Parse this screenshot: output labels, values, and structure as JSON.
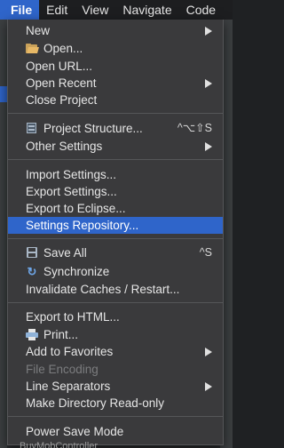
{
  "menubar": {
    "items": [
      {
        "label": "File",
        "active": true
      },
      {
        "label": "Edit"
      },
      {
        "label": "View"
      },
      {
        "label": "Navigate"
      },
      {
        "label": "Code"
      }
    ]
  },
  "file_menu": {
    "new": {
      "label": "New",
      "submenu": true
    },
    "open": {
      "label": "Open...",
      "icon": "folder-icon"
    },
    "open_url": {
      "label": "Open URL..."
    },
    "open_recent": {
      "label": "Open Recent",
      "submenu": true
    },
    "close_project": {
      "label": "Close Project"
    },
    "project_structure": {
      "label": "Project Structure...",
      "icon": "project-structure-icon",
      "shortcut": "^⌥⇧S"
    },
    "other_settings": {
      "label": "Other Settings",
      "submenu": true
    },
    "import_settings": {
      "label": "Import Settings..."
    },
    "export_settings": {
      "label": "Export Settings..."
    },
    "export_eclipse": {
      "label": "Export to Eclipse..."
    },
    "settings_repository": {
      "label": "Settings Repository...",
      "selected": true
    },
    "save_all": {
      "label": "Save All",
      "icon": "save-icon",
      "shortcut": "^S"
    },
    "synchronize": {
      "label": "Synchronize",
      "icon": "sync-icon"
    },
    "invalidate_caches": {
      "label": "Invalidate Caches / Restart..."
    },
    "export_html": {
      "label": "Export to HTML..."
    },
    "print": {
      "label": "Print...",
      "icon": "print-icon"
    },
    "add_favorites": {
      "label": "Add to Favorites",
      "submenu": true
    },
    "file_encoding": {
      "label": "File Encoding",
      "disabled": true
    },
    "line_separators": {
      "label": "Line Separators",
      "submenu": true
    },
    "make_readonly": {
      "label": "Make Directory Read-only"
    },
    "power_save": {
      "label": "Power Save Mode"
    }
  },
  "background": {
    "peek_text": "BuyMobController"
  },
  "colors": {
    "accent": "#2f65ca",
    "menu_bg": "#3a3a3c",
    "menubar_bg": "#1d1e20",
    "text": "#e6e6e6",
    "disabled_text": "#7b7c7e"
  }
}
